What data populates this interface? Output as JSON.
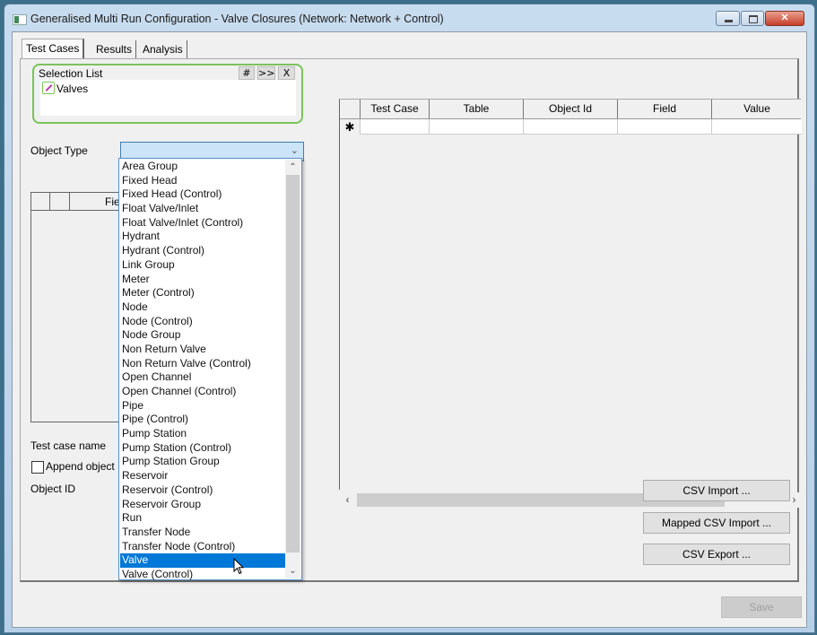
{
  "window": {
    "title": "Generalised Multi Run Configuration  - Valve Closures (Network: Network + Control)",
    "controls": {
      "minimize_icon": "minimize-icon",
      "maximize_icon": "maximize-icon",
      "close_label": "✕"
    }
  },
  "tabs": [
    {
      "label": "Test Cases",
      "active": true
    },
    {
      "label": "Results",
      "active": false
    },
    {
      "label": "Analysis",
      "active": false
    }
  ],
  "selection_list": {
    "title": "Selection List",
    "buttons": [
      "#",
      ">>",
      "X"
    ],
    "items": [
      {
        "label": "Valves",
        "icon": "valve-selection-icon"
      }
    ]
  },
  "form": {
    "object_type_label": "Object Type",
    "object_type_value": "",
    "fields_grid_header": "Fie",
    "test_case_name_label": "Test case name",
    "append_object_label": "Append object",
    "append_object_checked": false,
    "object_id_label": "Object ID"
  },
  "dropdown": {
    "items": [
      "Area Group",
      "Fixed Head",
      "Fixed Head (Control)",
      "Float Valve/Inlet",
      "Float Valve/Inlet (Control)",
      "Hydrant",
      "Hydrant (Control)",
      "Link Group",
      "Meter",
      "Meter (Control)",
      "Node",
      "Node (Control)",
      "Node Group",
      "Non Return Valve",
      "Non Return Valve (Control)",
      "Open Channel",
      "Open Channel (Control)",
      "Pipe",
      "Pipe (Control)",
      "Pump Station",
      "Pump Station (Control)",
      "Pump Station Group",
      "Reservoir",
      "Reservoir (Control)",
      "Reservoir Group",
      "Run",
      "Transfer Node",
      "Transfer Node (Control)",
      "Valve",
      "Valve (Control)"
    ],
    "highlighted": "Valve",
    "up_arrow": "⌃",
    "down_arrow": "⌄"
  },
  "grid": {
    "columns": [
      "Test Case",
      "Table",
      "Object Id",
      "Field",
      "Value"
    ],
    "new_row_marker": "✱",
    "rows": [],
    "scroll_left": "‹",
    "scroll_right": "›"
  },
  "actions": {
    "csv_import": "CSV Import ...",
    "mapped_csv_import": "Mapped CSV Import ...",
    "csv_export": "CSV Export ...",
    "save": "Save"
  },
  "colors": {
    "selection_border": "#7ac35a",
    "highlight": "#0078d7",
    "combo_focus": "#cce4f7"
  }
}
